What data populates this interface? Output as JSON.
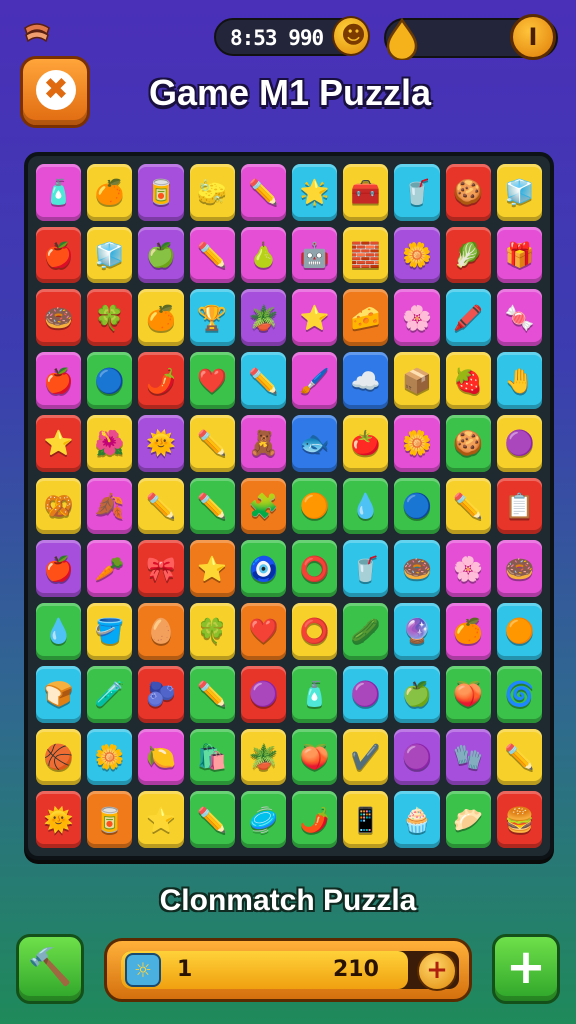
{
  "header": {
    "stat_text": "8:53 990",
    "energy_button_label": "I"
  },
  "title": "Game M1 Puzzla",
  "footer": {
    "title": "Clonmatch Puzzla",
    "left_button_icon": "hammer-icon",
    "right_button_label": "+",
    "progress": {
      "level": "1",
      "target": "210",
      "fill": 0.85,
      "plus_label": "+"
    }
  },
  "board": {
    "rows": [
      [
        [
          "#e44fd6",
          "🧴"
        ],
        [
          "#f7d12a",
          "🍊"
        ],
        [
          "#a64fdc",
          "🥫"
        ],
        [
          "#f7d12a",
          "🧽"
        ],
        [
          "#e44fd6",
          "✏️"
        ],
        [
          "#2fc4e8",
          "🌟"
        ],
        [
          "#f7d12a",
          "🧰"
        ],
        [
          "#2fc4e8",
          "🥤"
        ],
        [
          "#e8352a",
          "🍪"
        ],
        [
          "#f7d12a",
          "🧊"
        ]
      ],
      [
        [
          "#e8352a",
          "🍎"
        ],
        [
          "#f7d12a",
          "🧊"
        ],
        [
          "#a64fdc",
          "🍏"
        ],
        [
          "#e44fd6",
          "✏️"
        ],
        [
          "#e44fd6",
          "🍐"
        ],
        [
          "#e44fd6",
          "🤖"
        ],
        [
          "#f7d12a",
          "🧱"
        ],
        [
          "#a64fdc",
          "🌼"
        ],
        [
          "#e8352a",
          "🥬"
        ],
        [
          "#e44fd6",
          "🎁"
        ]
      ],
      [
        [
          "#e8352a",
          "🍩"
        ],
        [
          "#e8352a",
          "🍀"
        ],
        [
          "#f7d12a",
          "🍊"
        ],
        [
          "#2fc4e8",
          "🏆"
        ],
        [
          "#a64fdc",
          "🪴"
        ],
        [
          "#e44fd6",
          "⭐"
        ],
        [
          "#f07a1a",
          "🧀"
        ],
        [
          "#e44fd6",
          "🌸"
        ],
        [
          "#2fc4e8",
          "🖍️"
        ],
        [
          "#e44fd6",
          "🍬"
        ]
      ],
      [
        [
          "#e44fd6",
          "🍎"
        ],
        [
          "#3ac24a",
          "🔵"
        ],
        [
          "#e8352a",
          "🌶️"
        ],
        [
          "#3ac24a",
          "❤️"
        ],
        [
          "#2fc4e8",
          "✏️"
        ],
        [
          "#e44fd6",
          "🖌️"
        ],
        [
          "#2f7ae8",
          "☁️"
        ],
        [
          "#f7d12a",
          "📦"
        ],
        [
          "#f7d12a",
          "🍓"
        ],
        [
          "#2fc4e8",
          "🤚"
        ]
      ],
      [
        [
          "#e8352a",
          "⭐"
        ],
        [
          "#f7d12a",
          "🌺"
        ],
        [
          "#a64fdc",
          "🌞"
        ],
        [
          "#f7d12a",
          "✏️"
        ],
        [
          "#e44fd6",
          "🧸"
        ],
        [
          "#2f7ae8",
          "🐟"
        ],
        [
          "#f7d12a",
          "🍅"
        ],
        [
          "#e44fd6",
          "🌼"
        ],
        [
          "#3ac24a",
          "🍪"
        ],
        [
          "#f7d12a",
          "🟣"
        ]
      ],
      [
        [
          "#f7d12a",
          "🥨"
        ],
        [
          "#e44fd6",
          "🍂"
        ],
        [
          "#f7d12a",
          "✏️"
        ],
        [
          "#3ac24a",
          "✏️"
        ],
        [
          "#f07a1a",
          "🧩"
        ],
        [
          "#3ac24a",
          "🟠"
        ],
        [
          "#3ac24a",
          "💧"
        ],
        [
          "#3ac24a",
          "🔵"
        ],
        [
          "#f7d12a",
          "✏️"
        ],
        [
          "#e8352a",
          "📋"
        ]
      ],
      [
        [
          "#a64fdc",
          "🍎"
        ],
        [
          "#e44fd6",
          "🥕"
        ],
        [
          "#e8352a",
          "🎀"
        ],
        [
          "#f07a1a",
          "⭐"
        ],
        [
          "#3ac24a",
          "🧿"
        ],
        [
          "#3ac24a",
          "⭕"
        ],
        [
          "#2fc4e8",
          "🥤"
        ],
        [
          "#2fc4e8",
          "🍩"
        ],
        [
          "#e44fd6",
          "🌸"
        ],
        [
          "#e44fd6",
          "🍩"
        ]
      ],
      [
        [
          "#3ac24a",
          "💧"
        ],
        [
          "#f7d12a",
          "🪣"
        ],
        [
          "#f07a1a",
          "🥚"
        ],
        [
          "#f7d12a",
          "🍀"
        ],
        [
          "#f07a1a",
          "❤️"
        ],
        [
          "#f7d12a",
          "⭕"
        ],
        [
          "#3ac24a",
          "🥒"
        ],
        [
          "#2fc4e8",
          "🔮"
        ],
        [
          "#e44fd6",
          "🍊"
        ],
        [
          "#2fc4e8",
          "🟠"
        ]
      ],
      [
        [
          "#2fc4e8",
          "🍞"
        ],
        [
          "#3ac24a",
          "🧪"
        ],
        [
          "#e8352a",
          "🫐"
        ],
        [
          "#3ac24a",
          "✏️"
        ],
        [
          "#e8352a",
          "🟣"
        ],
        [
          "#3ac24a",
          "🧴"
        ],
        [
          "#2fc4e8",
          "🟣"
        ],
        [
          "#2fc4e8",
          "🍏"
        ],
        [
          "#3ac24a",
          "🍑"
        ],
        [
          "#3ac24a",
          "🌀"
        ]
      ],
      [
        [
          "#f7d12a",
          "🏀"
        ],
        [
          "#2fc4e8",
          "🌼"
        ],
        [
          "#e44fd6",
          "🍋"
        ],
        [
          "#3ac24a",
          "🛍️"
        ],
        [
          "#f7d12a",
          "🪴"
        ],
        [
          "#3ac24a",
          "🍑"
        ],
        [
          "#f7d12a",
          "✔️"
        ],
        [
          "#a64fdc",
          "🟣"
        ],
        [
          "#a64fdc",
          "🧤"
        ],
        [
          "#f7d12a",
          "✏️"
        ]
      ],
      [
        [
          "#e8352a",
          "🌞"
        ],
        [
          "#f07a1a",
          "🥫"
        ],
        [
          "#f7d12a",
          "⭐"
        ],
        [
          "#3ac24a",
          "✏️"
        ],
        [
          "#3ac24a",
          "🥏"
        ],
        [
          "#3ac24a",
          "🌶️"
        ],
        [
          "#f7d12a",
          "📱"
        ],
        [
          "#2fc4e8",
          "🧁"
        ],
        [
          "#3ac24a",
          "🥟"
        ],
        [
          "#e8352a",
          "🍔"
        ]
      ]
    ]
  }
}
